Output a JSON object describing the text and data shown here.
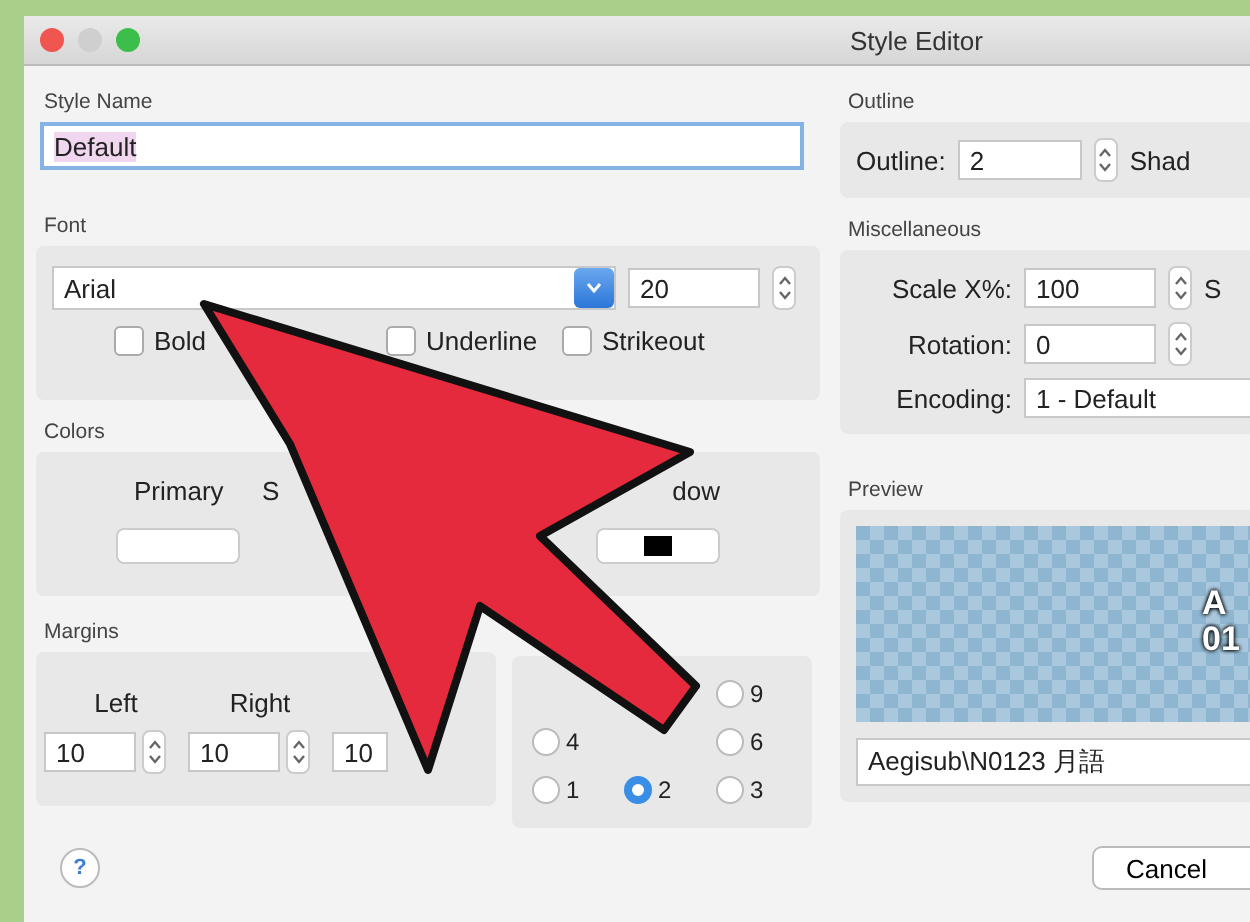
{
  "window": {
    "title": "Style Editor"
  },
  "style_name": {
    "label": "Style Name",
    "value": "Default"
  },
  "font": {
    "label": "Font",
    "name": "Arial",
    "size": "20",
    "options": [
      {
        "label": "Bold",
        "checked": false
      },
      {
        "label": "Underline",
        "checked": false
      },
      {
        "label": "Strikeout",
        "checked": false
      }
    ]
  },
  "colors": {
    "label": "Colors",
    "labels": [
      "Primary",
      "S",
      "dow"
    ],
    "swatches": [
      {
        "kind": "empty"
      },
      {
        "kind": "chip",
        "color": "#000000"
      }
    ]
  },
  "margins": {
    "label": "Margins",
    "columns": [
      "Left",
      "Right"
    ],
    "values": [
      "10",
      "10",
      "10"
    ]
  },
  "alignment": [
    {
      "label": "9",
      "selected": false
    },
    {
      "label": "4",
      "selected": false
    },
    {
      "label": "6",
      "selected": false
    },
    {
      "label": "1",
      "selected": false
    },
    {
      "label": "2",
      "selected": true
    },
    {
      "label": "3",
      "selected": false
    }
  ],
  "help": "?",
  "outline": {
    "label": "Outline",
    "field_label": "Outline:",
    "value": "2",
    "next_label": "Shad"
  },
  "misc": {
    "label": "Miscellaneous",
    "scale_label": "Scale X%:",
    "scale": "100",
    "next_label": "S",
    "rotation_label": "Rotation:",
    "rotation": "0",
    "encoding_label": "Encoding:",
    "encoding": "1 - Default"
  },
  "preview": {
    "label": "Preview",
    "lines": [
      "A",
      "01"
    ],
    "text": "Aegisub\\N0123 月語"
  },
  "buttons": [
    "Cancel"
  ]
}
